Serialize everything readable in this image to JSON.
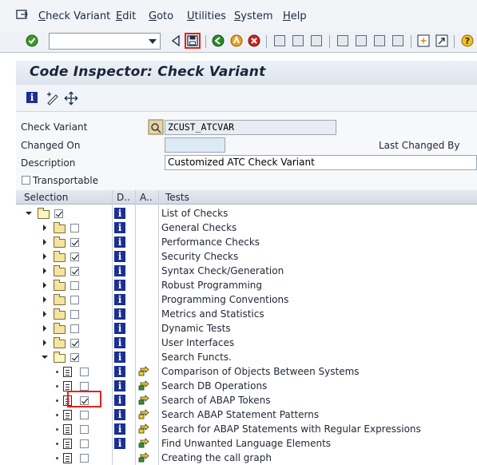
{
  "menu": {
    "items": [
      "Check Variant",
      "Edit",
      "Goto",
      "Utilities",
      "System",
      "Help"
    ]
  },
  "toolbar": {
    "command_field_value": "",
    "buttons": [
      "enter-icon",
      "back-arrow-icon",
      "save-icon",
      "back-icon",
      "exit-icon",
      "cancel-icon",
      "print-icon",
      "find-icon",
      "find-next-icon",
      "first-page-icon",
      "previous-page-icon",
      "next-page-icon",
      "last-page-icon",
      "create-session-icon",
      "shortcut-icon",
      "help-icon"
    ]
  },
  "page": {
    "title": "Code Inspector: Check Variant"
  },
  "app_toolbar": {
    "buttons": [
      "information-icon",
      "edit-icon",
      "move-icon"
    ]
  },
  "form": {
    "check_variant_label": "Check Variant",
    "check_variant_value": "ZCUST_ATCVAR",
    "changed_on_label": "Changed On",
    "changed_on_value": "",
    "last_changed_by_label": "Last Changed By",
    "description_label": "Description",
    "description_value": "Customized ATC Check Variant",
    "transportable_label": "Transportable",
    "transportable_checked": false
  },
  "table": {
    "headers": {
      "selection": "Selection",
      "d": "D..",
      "a": "A..",
      "tests": "Tests"
    },
    "rows": [
      {
        "level": 0,
        "type": "folder",
        "expanded": true,
        "checked": true,
        "has_info": true,
        "has_attr": false,
        "text": "List of Checks"
      },
      {
        "level": 1,
        "type": "folder",
        "expanded": false,
        "checked": false,
        "has_info": true,
        "has_attr": false,
        "text": "General Checks"
      },
      {
        "level": 1,
        "type": "folder",
        "expanded": false,
        "checked": true,
        "has_info": true,
        "has_attr": false,
        "text": "Performance Checks"
      },
      {
        "level": 1,
        "type": "folder",
        "expanded": false,
        "checked": true,
        "has_info": true,
        "has_attr": false,
        "text": "Security Checks"
      },
      {
        "level": 1,
        "type": "folder",
        "expanded": false,
        "checked": true,
        "has_info": true,
        "has_attr": false,
        "text": "Syntax Check/Generation"
      },
      {
        "level": 1,
        "type": "folder",
        "expanded": false,
        "checked": false,
        "has_info": true,
        "has_attr": false,
        "text": "Robust Programming"
      },
      {
        "level": 1,
        "type": "folder",
        "expanded": false,
        "checked": false,
        "has_info": true,
        "has_attr": false,
        "text": "Programming Conventions"
      },
      {
        "level": 1,
        "type": "folder",
        "expanded": false,
        "checked": false,
        "has_info": true,
        "has_attr": false,
        "text": "Metrics and Statistics"
      },
      {
        "level": 1,
        "type": "folder",
        "expanded": false,
        "checked": false,
        "has_info": true,
        "has_attr": false,
        "text": "Dynamic Tests"
      },
      {
        "level": 1,
        "type": "folder",
        "expanded": false,
        "checked": true,
        "has_info": true,
        "has_attr": false,
        "text": "User Interfaces"
      },
      {
        "level": 1,
        "type": "folder",
        "expanded": true,
        "checked": true,
        "has_info": true,
        "has_attr": false,
        "text": "Search Functs."
      },
      {
        "level": 2,
        "type": "doc",
        "checked": false,
        "has_info": true,
        "has_attr": true,
        "attr_color": "yellow",
        "text": "Comparison of Objects Between Systems"
      },
      {
        "level": 2,
        "type": "doc",
        "checked": false,
        "has_info": true,
        "has_attr": true,
        "attr_color": "green",
        "text": "Search DB Operations"
      },
      {
        "level": 2,
        "type": "doc",
        "checked": true,
        "highlighted": true,
        "has_info": true,
        "has_attr": true,
        "attr_color": "green",
        "text": "Search of ABAP Tokens"
      },
      {
        "level": 2,
        "type": "doc",
        "checked": false,
        "has_info": true,
        "has_attr": true,
        "attr_color": "yellow",
        "text": "Search ABAP Statement Patterns"
      },
      {
        "level": 2,
        "type": "doc",
        "checked": false,
        "has_info": true,
        "has_attr": true,
        "attr_color": "yellow",
        "text": "Search for ABAP Statements with Regular Expressions"
      },
      {
        "level": 2,
        "type": "doc",
        "checked": false,
        "has_info": true,
        "has_attr": true,
        "attr_color": "green",
        "text": "Find Unwanted Language Elements"
      },
      {
        "level": 2,
        "type": "doc",
        "checked": false,
        "has_info": false,
        "has_attr": true,
        "attr_color": "green",
        "text": "Creating the call graph"
      }
    ]
  },
  "colors": {
    "info_icon": "#1b2f94",
    "highlight": "#e2231a",
    "attr_yellow": "#f0d020",
    "attr_green": "#2a9a2a"
  }
}
